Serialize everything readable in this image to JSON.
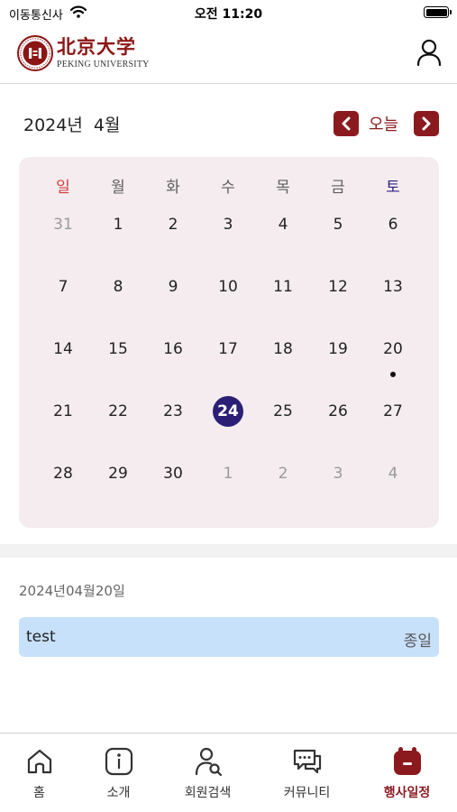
{
  "status_bar": {
    "carrier": "이동통신사",
    "time": "오전 11:20"
  },
  "header": {
    "logo_text_cn": "北京大学",
    "logo_text_en": "PEKING UNIVERSITY",
    "user_icon": "user-icon"
  },
  "calendar": {
    "month_title": "2024년  4월",
    "today_label": "오늘",
    "weekdays": [
      "일",
      "월",
      "화",
      "수",
      "목",
      "금",
      "토"
    ],
    "weeks": [
      [
        {
          "d": "31",
          "other": true
        },
        {
          "d": "1"
        },
        {
          "d": "2"
        },
        {
          "d": "3"
        },
        {
          "d": "4"
        },
        {
          "d": "5"
        },
        {
          "d": "6"
        }
      ],
      [
        {
          "d": "7"
        },
        {
          "d": "8"
        },
        {
          "d": "9"
        },
        {
          "d": "10"
        },
        {
          "d": "11"
        },
        {
          "d": "12"
        },
        {
          "d": "13"
        }
      ],
      [
        {
          "d": "14"
        },
        {
          "d": "15"
        },
        {
          "d": "16"
        },
        {
          "d": "17"
        },
        {
          "d": "18"
        },
        {
          "d": "19"
        },
        {
          "d": "20",
          "event": true
        }
      ],
      [
        {
          "d": "21"
        },
        {
          "d": "22"
        },
        {
          "d": "23"
        },
        {
          "d": "24",
          "selected": true
        },
        {
          "d": "25"
        },
        {
          "d": "26"
        },
        {
          "d": "27"
        }
      ],
      [
        {
          "d": "28"
        },
        {
          "d": "29"
        },
        {
          "d": "30"
        },
        {
          "d": "1",
          "other": true
        },
        {
          "d": "2",
          "other": true
        },
        {
          "d": "3",
          "other": true
        },
        {
          "d": "4",
          "other": true
        }
      ]
    ],
    "colors": {
      "accent": "#8b1a1f",
      "selected": "#2b1f75",
      "sunday": "#d23b3b",
      "saturday": "#2f2480",
      "background": "#f4ecef"
    }
  },
  "events": {
    "selected_date": "2024년04월20일",
    "items": [
      {
        "title": "test",
        "time": "종일",
        "color": "#c8e1fb"
      }
    ]
  },
  "tabs": [
    {
      "label": "홈",
      "icon": "home-icon",
      "active": false
    },
    {
      "label": "소개",
      "icon": "info-icon",
      "active": false
    },
    {
      "label": "회원검색",
      "icon": "member-search-icon",
      "active": false
    },
    {
      "label": "커뮤니티",
      "icon": "chat-icon",
      "active": false
    },
    {
      "label": "행사일정",
      "icon": "calendar-icon",
      "active": true
    }
  ]
}
